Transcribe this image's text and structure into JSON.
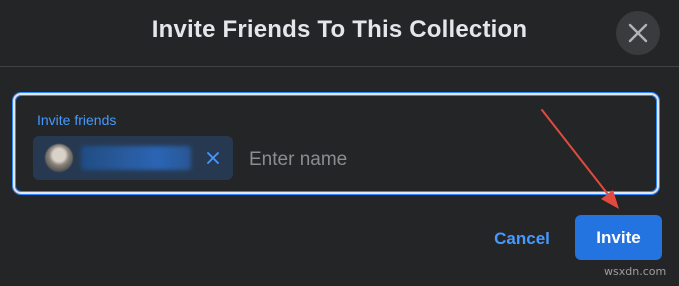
{
  "dialog": {
    "title": "Invite Friends To This Collection",
    "close_icon": "close-icon"
  },
  "invite_field": {
    "label": "Invite friends",
    "placeholder": "Enter name",
    "chip": {
      "avatar_icon": "avatar-blurred",
      "remove_icon": "remove-icon"
    }
  },
  "actions": {
    "cancel_label": "Cancel",
    "invite_label": "Invite"
  },
  "annotation": {
    "arrow_color": "#e04a3f"
  },
  "watermark": "wsxdn.com",
  "colors": {
    "background": "#242526",
    "accent": "#2374e1",
    "link": "#4599ff",
    "text": "#e4e6eb"
  }
}
